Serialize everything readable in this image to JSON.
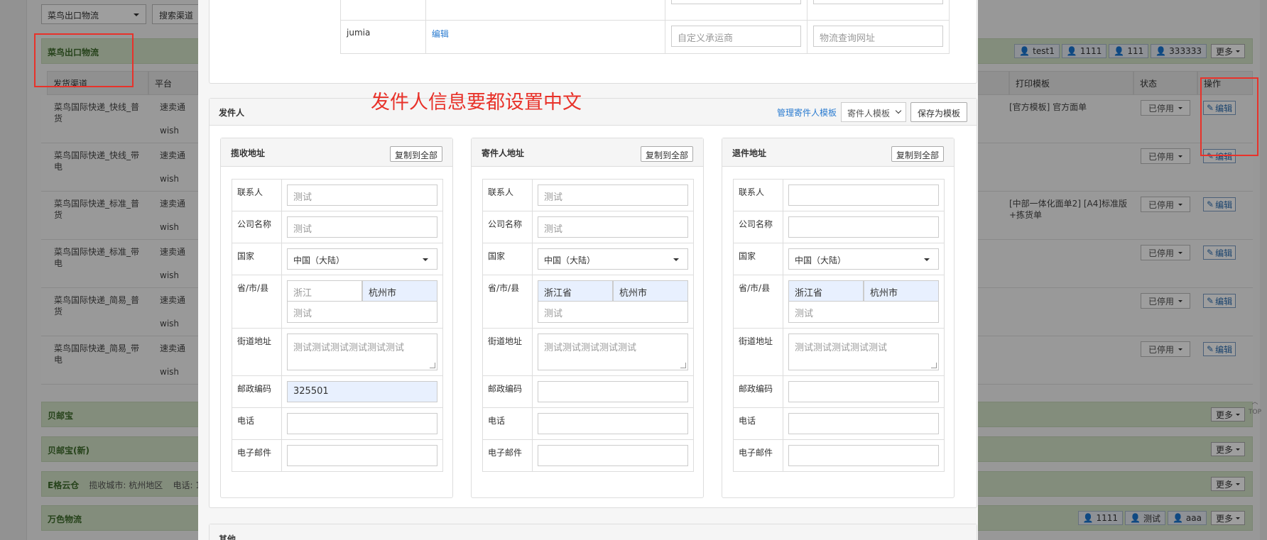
{
  "bg": {
    "channel_select": "菜鸟出口物流",
    "search_button": "搜索渠道",
    "group1_title": "菜鸟出口物流",
    "group1_tags": [
      "test1",
      "1111",
      "111",
      "333333"
    ],
    "more_label": "更多",
    "columns": {
      "channel": "发货渠道",
      "platform": "平台",
      "print_template": "打印模板",
      "status": "状态",
      "action": "操作"
    },
    "rows": [
      {
        "channel": "菜鸟国际快递_快线_普货",
        "platform1": "速卖通",
        "platform2": "wish",
        "template": "[官方模板] 官方面单",
        "status": "已停用",
        "edit": "编辑"
      },
      {
        "channel": "菜鸟国际快递_快线_带电",
        "platform1": "速卖通",
        "platform2": "wish",
        "template": "",
        "status": "已停用",
        "edit": "编辑"
      },
      {
        "channel": "菜鸟国际快递_标准_普货",
        "platform1": "速卖通",
        "platform2": "wish",
        "template": "[中部一体化面单2] [A4]标准版+拣货单",
        "status": "已停用",
        "edit": "编辑"
      },
      {
        "channel": "菜鸟国际快递_标准_带电",
        "platform1": "速卖通",
        "platform2": "wish",
        "template": "",
        "status": "已停用",
        "edit": "编辑"
      },
      {
        "channel": "菜鸟国际快递_简易_普货",
        "platform1": "速卖通",
        "platform2": "wish",
        "template": "",
        "status": "已停用",
        "edit": "编辑"
      },
      {
        "channel": "菜鸟国际快递_简易_带电",
        "platform1": "速卖通",
        "platform2": "wish",
        "template": "",
        "status": "已停用",
        "edit": "编辑"
      }
    ],
    "group2_title": "贝邮宝",
    "group3_title": "贝邮宝(新)",
    "group4_title": "E格云仓",
    "group4_city": "揽收城市: 杭州地区",
    "group4_phone": "电话: 1",
    "group5_title": "万色物流",
    "group5_tags": [
      "1111",
      "测试",
      "aaa"
    ],
    "totop": "TOP"
  },
  "carrier_table": {
    "platform": "jumia",
    "edit_link": "编辑",
    "carrier_placeholder": "自定义承运商",
    "tracking_placeholder": "物流查询网址"
  },
  "annotation": "发件人信息要都设置中文",
  "sender": {
    "title": "发件人",
    "manage_link": "管理寄件人模板",
    "template_select": "寄件人模板",
    "save_button": "保存为模板",
    "copy_label": "复制到全部",
    "labels": {
      "contact": "联系人",
      "company": "公司名称",
      "country": "国家",
      "region": "省/市/县",
      "street": "街道地址",
      "postal": "邮政编码",
      "phone": "电话",
      "email": "电子邮件"
    },
    "panels": [
      {
        "title": "揽收地址",
        "contact": "测试",
        "company": "测试",
        "country": "中国（大陆）",
        "province": "浙江",
        "city": "杭州市",
        "county": "测试",
        "street": "测试测试测试测试测试测试",
        "postal": "325501",
        "phone": "",
        "email": ""
      },
      {
        "title": "寄件人地址",
        "contact": "测试",
        "company": "测试",
        "country": "中国（大陆）",
        "province": "浙江省",
        "city": "杭州市",
        "county": "测试",
        "street": "测试测试测试测试测试",
        "postal": "",
        "phone": "",
        "email": ""
      },
      {
        "title": "退件地址",
        "contact": "",
        "company": "",
        "country": "中国（大陆）",
        "province": "浙江省",
        "city": "杭州市",
        "county": "测试",
        "street": "测试测试测试测试测试",
        "postal": "",
        "phone": "",
        "email": ""
      }
    ]
  },
  "other": {
    "title": "其他"
  }
}
